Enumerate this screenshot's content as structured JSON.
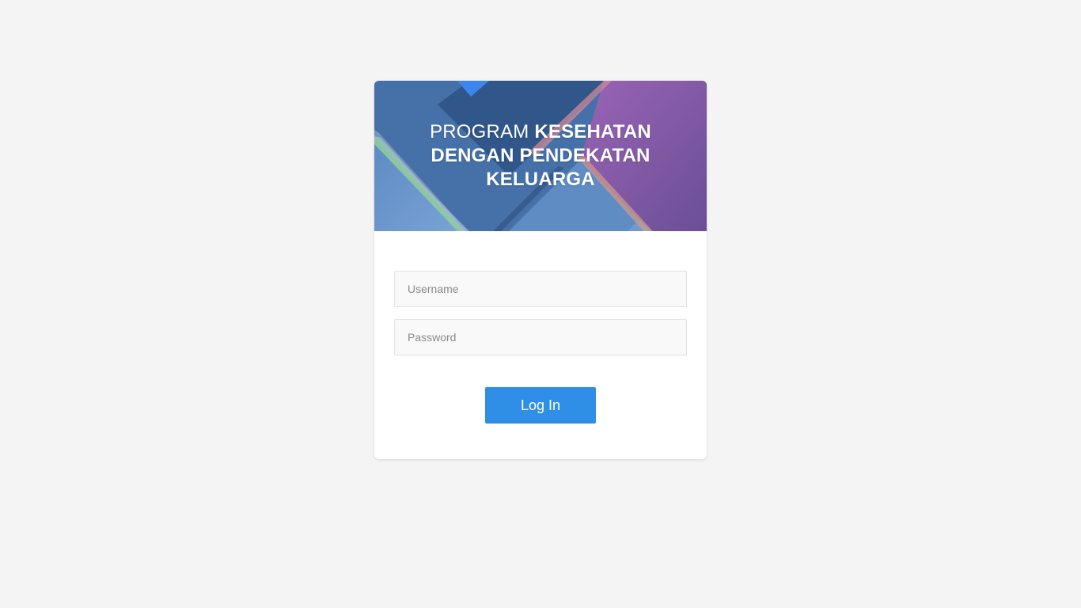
{
  "banner": {
    "title_light": "PROGRAM ",
    "title_bold": "KESEHATAN DENGAN PENDEKATAN KELUARGA"
  },
  "form": {
    "username": {
      "value": "",
      "placeholder": "Username"
    },
    "password": {
      "value": "",
      "placeholder": "Password"
    },
    "submit_label": "Log In"
  },
  "colors": {
    "page_background": "#f4f4f4",
    "banner_base": "#3f66a0",
    "button": "#2f8fe6"
  }
}
